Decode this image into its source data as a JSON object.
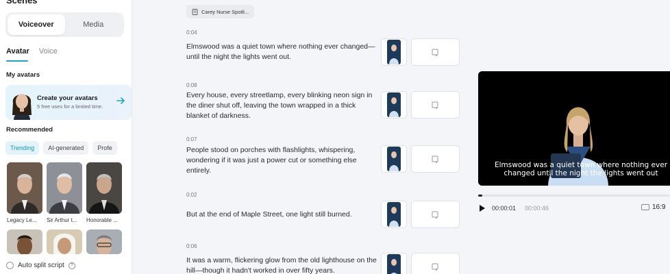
{
  "sidebar": {
    "title": "Scenes",
    "segments": [
      "Voiceover",
      "Media"
    ],
    "subtabs": [
      "Avatar",
      "Voice"
    ],
    "my_avatars_label": "My avatars",
    "create_card": {
      "title": "Create your avatars",
      "subtitle": "5 free uses for a limited time."
    },
    "recommended_label": "Recommended",
    "chips": [
      "Trending",
      "AI-generated",
      "Profe"
    ],
    "avatars": [
      {
        "name": "Legacy Le..."
      },
      {
        "name": "Sir Arthur t..."
      },
      {
        "name": "Honorable ..."
      }
    ],
    "auto_split_label": "Auto split script",
    "help_glyph": "?"
  },
  "script": {
    "file_label": "Carey Nurse Spotli...",
    "scenes": [
      {
        "time": "0:04",
        "text": "Elmswood was a quiet town where nothing ever changed—until the night the lights went out."
      },
      {
        "time": "0:08",
        "text": "Every house, every streetlamp, every blinking neon sign in the diner shut off, leaving the town wrapped in a thick blanket of darkness."
      },
      {
        "time": "0:07",
        "text": "People stood on porches with flashlights, whispering, wondering if it was just a power cut or something else entirely."
      },
      {
        "time": "0:02",
        "text": "But at the end of Maple Street, one light still burned."
      },
      {
        "time": "0:06",
        "text": "It was a warm, flickering glow from the old lighthouse on the hill—though it hadn't worked in over fifty years."
      }
    ]
  },
  "preview": {
    "caption": "Elmswood was a quiet town where nothing ever changed until the night the lights went out",
    "current_time": "00:00:01",
    "total_time": "00:00:46",
    "progress": 0.02,
    "aspect_ratio": "16:9"
  },
  "colors": {
    "accent": "#1aa6c9",
    "background": "#f4f5f8"
  }
}
